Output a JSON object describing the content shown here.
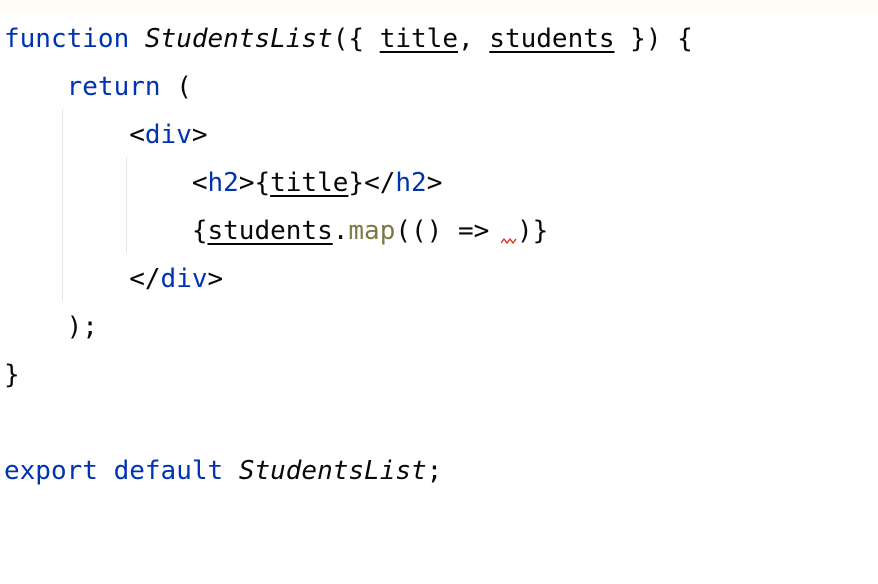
{
  "code": {
    "line1": {
      "keyword": "function",
      "name": "StudentsList",
      "open": "({ ",
      "param1": "title",
      "comma": ", ",
      "param2": "students",
      "close": " }) {"
    },
    "line2": {
      "indent": "    ",
      "keyword": "return",
      "rest": " ("
    },
    "line3": {
      "indent": "        ",
      "open": "<",
      "tag": "div",
      "close": ">"
    },
    "line4": {
      "indent": "            ",
      "open_lt": "<",
      "tag_open": "h2",
      "open_gt": ">",
      "brace_open": "{",
      "expr": "title",
      "brace_close": "}",
      "close_lt": "</",
      "tag_close": "h2",
      "close_gt": ">"
    },
    "line5": {
      "indent": "            ",
      "brace_open": "{",
      "object": "students",
      "dot": ".",
      "method": "map",
      "args": "(() => ",
      "rest": ")}"
    },
    "line6": {
      "indent": "        ",
      "open": "</",
      "tag": "div",
      "close": ">"
    },
    "line7": {
      "indent": "    ",
      "text": ");"
    },
    "line8": {
      "text": "}"
    },
    "line10": {
      "kw1": "export",
      "space1": " ",
      "kw2": "default",
      "space2": " ",
      "name": "StudentsList",
      "semi": ";"
    }
  },
  "colors": {
    "keyword": "#0033b3",
    "method": "#7a7a43",
    "text": "#080808",
    "error_squiggle": "#e0301e",
    "indent_guide": "#e6e6e6"
  }
}
